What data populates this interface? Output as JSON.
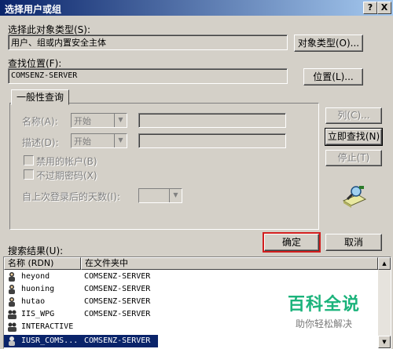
{
  "window": {
    "title": "选择用户或组",
    "help_btn": "?",
    "close_btn": "X"
  },
  "object_type": {
    "label": "选择此对象类型(S):",
    "value": "用户、组或内置安全主体",
    "button": "对象类型(O)..."
  },
  "location": {
    "label": "查找位置(F):",
    "value": "COMSENZ-SERVER",
    "button": "位置(L)..."
  },
  "query": {
    "tab": "一般性查询",
    "name_label": "名称(A):",
    "name_op": "开始",
    "desc_label": "描述(D):",
    "desc_op": "开始",
    "disabled_accounts": "禁用的帐户(B)",
    "no_expire_pw": "不过期密码(X)",
    "days_label": "自上次登录后的天数(I):",
    "btn_columns": "列(C)...",
    "btn_find_now": "立即查找(N)",
    "btn_stop": "停止(T)"
  },
  "actions": {
    "ok": "确定",
    "cancel": "取消"
  },
  "results": {
    "label": "搜索结果(U):",
    "col_name": "名称 (RDN)",
    "col_folder": "在文件夹中",
    "rows": [
      {
        "name": "heyond",
        "folder": "COMSENZ-SERVER"
      },
      {
        "name": "huoning",
        "folder": "COMSENZ-SERVER"
      },
      {
        "name": "hutao",
        "folder": "COMSENZ-SERVER"
      },
      {
        "name": "IIS_WPG",
        "folder": "COMSENZ-SERVER"
      },
      {
        "name": "INTERACTIVE",
        "folder": ""
      },
      {
        "name": "IUSR_COMS...",
        "folder": "COMSENZ-SERVER"
      }
    ]
  },
  "watermark": {
    "title": "百科全说",
    "subtitle": "助你轻松解决"
  }
}
